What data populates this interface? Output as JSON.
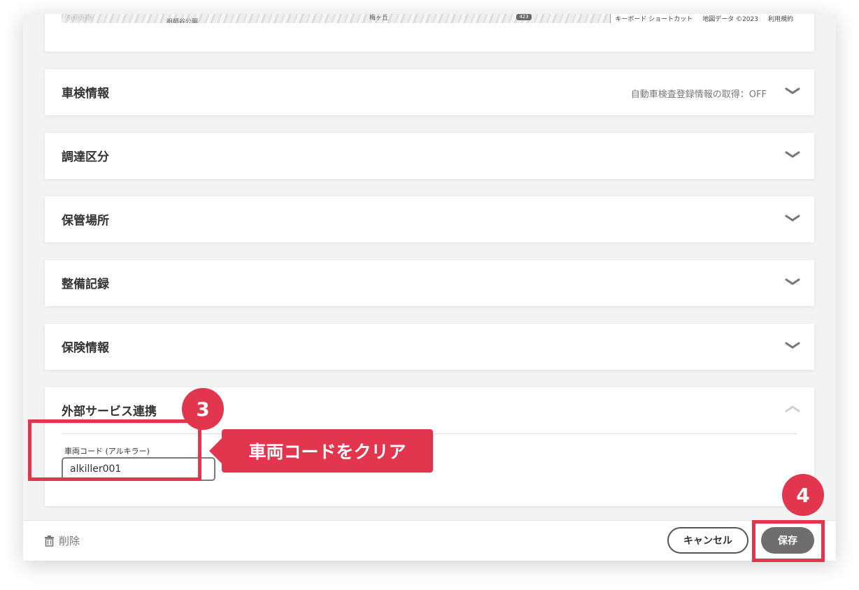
{
  "map": {
    "logo": "Google",
    "labels": [
      "祖師谷公園",
      "梅ヶ丘"
    ],
    "route_badge": "423",
    "attribution": {
      "shortcuts": "キーボード ショートカット",
      "map_data": "地図データ ©2023",
      "terms": "利用規約"
    }
  },
  "sections": [
    {
      "title": "車検情報",
      "status": "自動車検査登録情報の取得：OFF",
      "expanded": false
    },
    {
      "title": "調達区分",
      "status": "",
      "expanded": false
    },
    {
      "title": "保管場所",
      "status": "",
      "expanded": false
    },
    {
      "title": "整備記録",
      "status": "",
      "expanded": false
    },
    {
      "title": "保険情報",
      "status": "",
      "expanded": false
    }
  ],
  "external_service": {
    "title": "外部サービス連携",
    "expanded": true,
    "field_label": "車両コード (アルキラー)",
    "field_value": "alkiller001"
  },
  "annotations": {
    "step3": "3",
    "step4": "4",
    "callout": "車両コードをクリア",
    "color": "#e2364f"
  },
  "footer": {
    "delete_label": "削除",
    "cancel_label": "キャンセル",
    "save_label": "保存"
  },
  "icons": {
    "delete": "trash-icon",
    "collapsed": "chevron-down-icon",
    "expanded": "chevron-up-icon"
  }
}
